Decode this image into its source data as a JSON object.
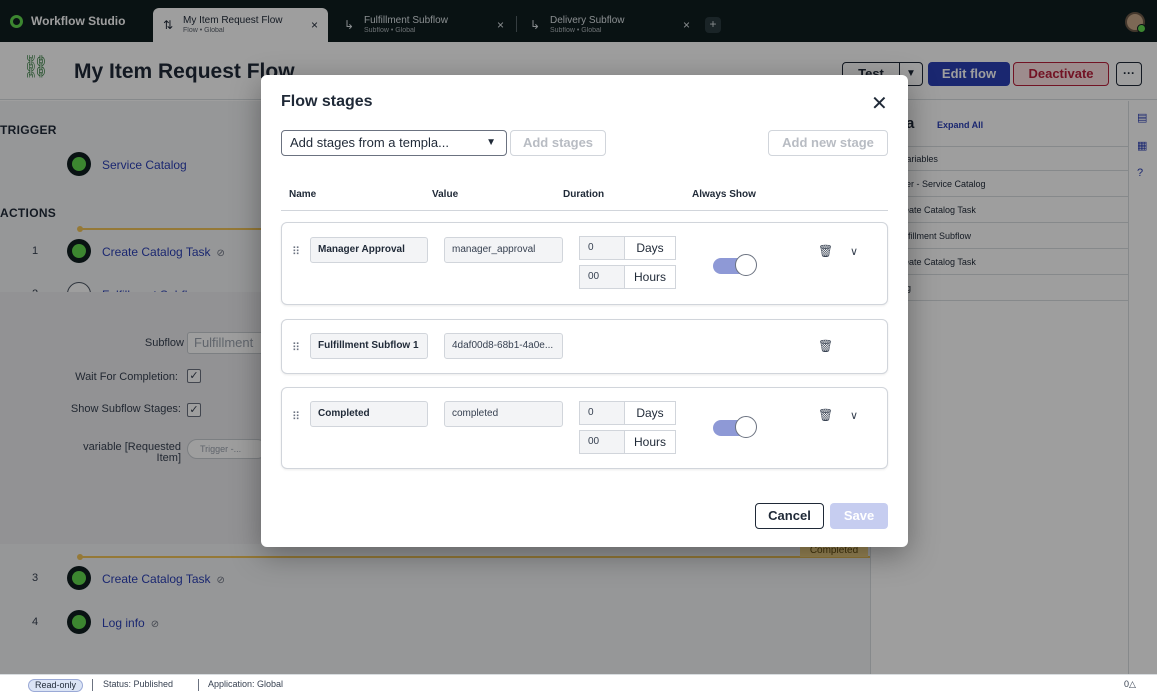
{
  "tabs": {
    "brand": "Workflow Studio",
    "items": [
      {
        "title": "My Item Request Flow",
        "subtitle": "Flow • Global"
      },
      {
        "title": "Fulfillment Subflow",
        "subtitle": "Subflow • Global"
      },
      {
        "title": "Delivery Subflow",
        "subtitle": "Subflow • Global"
      }
    ],
    "close_glyph": "×",
    "add_glyph": "+"
  },
  "header": {
    "title": "My Item Request Flow",
    "test_label": "Test",
    "edit_label": "Edit flow",
    "deactivate_label": "Deactivate",
    "more_glyph": "···"
  },
  "flow": {
    "trigger_heading": "TRIGGER",
    "trigger_label": "Service Catalog",
    "actions_heading": "ACTIONS",
    "actions": [
      {
        "num": "1",
        "label": "Create Catalog Task"
      },
      {
        "num": "2",
        "label": "Fulfillment Subflow"
      },
      {
        "num": "3",
        "label": "Create Catalog Task"
      },
      {
        "num": "4",
        "label": "Log info"
      }
    ],
    "subflow_detail": {
      "subflow_label": "Subflow",
      "subflow_value": "Fulfillment",
      "wait_label": "Wait For Completion:",
      "show_stages_label": "Show Subflow Stages:",
      "variable_label": "variable [Requested Item]",
      "variable_value": "Trigger -..."
    },
    "completed_tag": "Completed"
  },
  "data_pane": {
    "title": "ta",
    "expand_label": "Expand All",
    "rows": [
      "Variables",
      "ger - Service Catalog",
      "reate Catalog Task",
      "ulfillment Subflow",
      "reate Catalog Task",
      "og"
    ]
  },
  "status_bar": {
    "badge": "Read-only",
    "status": "Status: Published",
    "application": "Application: Global",
    "right": "0△"
  },
  "modal": {
    "title": "Flow stages",
    "template_placeholder": "Add stages from a templa...",
    "add_stages_label": "Add stages",
    "add_new_stage_label": "Add new stage",
    "columns": {
      "name": "Name",
      "value": "Value",
      "duration": "Duration",
      "always_show": "Always Show"
    },
    "stages": [
      {
        "name": "Manager Approval",
        "value": "manager_approval",
        "days": "0",
        "hours": "00",
        "days_unit": "Days",
        "hours_unit": "Hours"
      },
      {
        "name": "Fulfillment Subflow 1",
        "value": "4daf00d8-68b1-4a0e..."
      },
      {
        "name": "Completed",
        "value": "completed",
        "days": "0",
        "hours": "00",
        "days_unit": "Days",
        "hours_unit": "Hours"
      }
    ],
    "cancel_label": "Cancel",
    "save_label": "Save"
  }
}
